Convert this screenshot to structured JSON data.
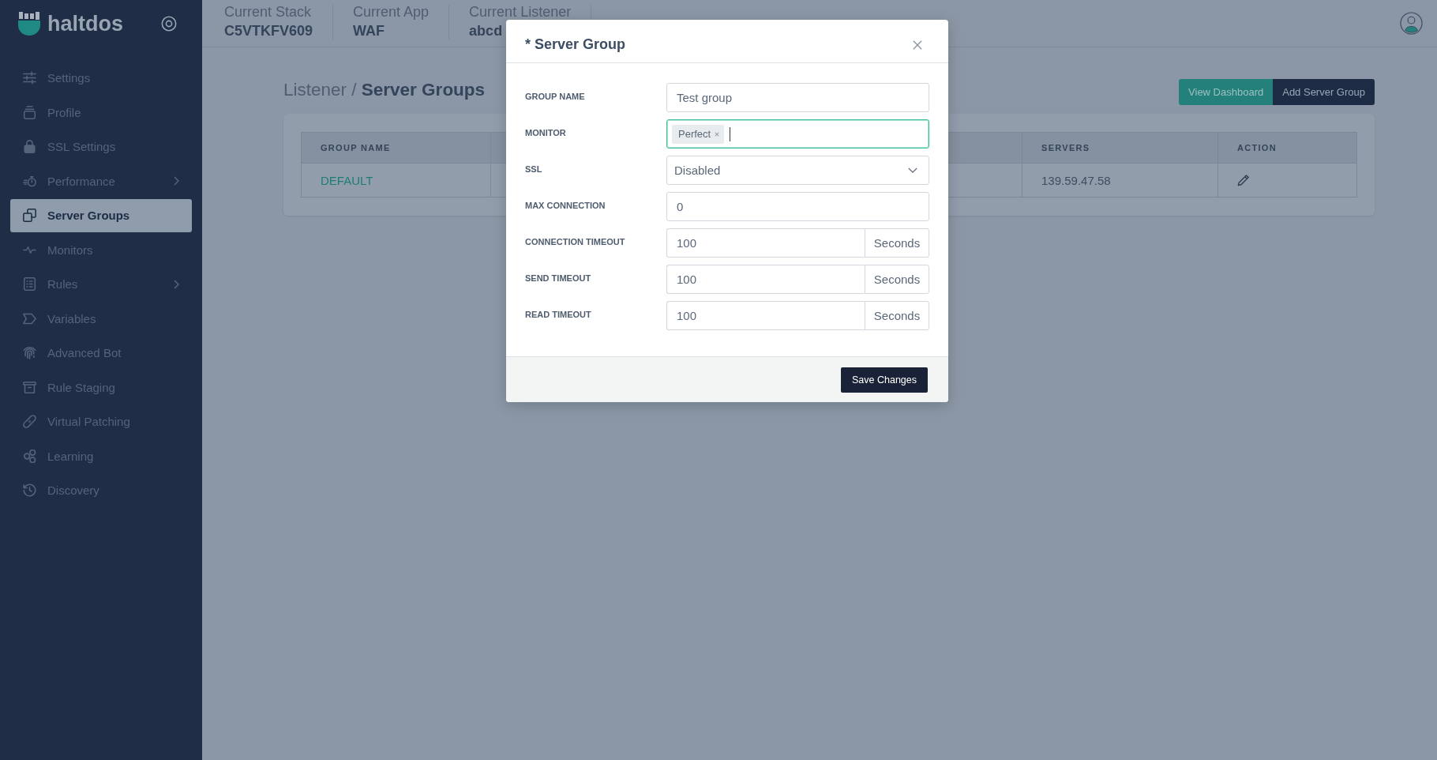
{
  "sidebar": {
    "logo": "haltdos",
    "items": [
      {
        "label": "Settings",
        "selected": false,
        "submenu": false
      },
      {
        "label": "Profile",
        "selected": false,
        "submenu": false
      },
      {
        "label": "SSL Settings",
        "selected": false,
        "submenu": false
      },
      {
        "label": "Performance",
        "selected": false,
        "submenu": true
      },
      {
        "label": "Server Groups",
        "selected": true,
        "submenu": false
      },
      {
        "label": "Monitors",
        "selected": false,
        "submenu": false
      },
      {
        "label": "Rules",
        "selected": false,
        "submenu": true
      },
      {
        "label": "Variables",
        "selected": false,
        "submenu": false
      },
      {
        "label": "Advanced Bot",
        "selected": false,
        "submenu": false
      },
      {
        "label": "Rule Staging",
        "selected": false,
        "submenu": false
      },
      {
        "label": "Virtual Patching",
        "selected": false,
        "submenu": false
      },
      {
        "label": "Learning",
        "selected": false,
        "submenu": false
      },
      {
        "label": "Discovery",
        "selected": false,
        "submenu": false
      }
    ]
  },
  "header": {
    "items": [
      {
        "label": "Current Stack",
        "value": "C5VTKFV609"
      },
      {
        "label": "Current App",
        "value": "WAF"
      },
      {
        "label": "Current Listener",
        "value": "abcd"
      }
    ]
  },
  "page": {
    "title": "Listener / **Server Groups**",
    "actions": [
      {
        "label": "View Dashboard",
        "kind": "accent"
      },
      {
        "label": "Add Server Group",
        "kind": "primary"
      }
    ]
  },
  "table": {
    "columns": [
      "GROUP NAME",
      "SERVERS",
      "ACTION"
    ],
    "rows": [
      {
        "group_name": "DEFAULT",
        "servers": "139.59.47.58"
      }
    ]
  },
  "modal": {
    "title": "* Server Group",
    "fields": [
      {
        "kind": "text",
        "label": "GROUP NAME",
        "value": "Test group",
        "focused": false
      },
      {
        "kind": "tags",
        "label": "MONITOR",
        "tags": [
          "Perfect"
        ],
        "focused": true
      },
      {
        "kind": "select",
        "label": "SSL",
        "value": "Disabled",
        "focused": false
      },
      {
        "kind": "text",
        "label": "MAX CONNECTION",
        "value": "0",
        "focused": false
      },
      {
        "kind": "unit",
        "label": "CONNECTION TIMEOUT",
        "value": "100",
        "unit": "Seconds",
        "focused": false
      },
      {
        "kind": "unit",
        "label": "SEND TIMEOUT",
        "value": "100",
        "unit": "Seconds",
        "focused": false
      },
      {
        "kind": "unit",
        "label": "READ TIMEOUT",
        "value": "100",
        "unit": "Seconds",
        "focused": false
      }
    ],
    "submit": "Save Changes"
  }
}
